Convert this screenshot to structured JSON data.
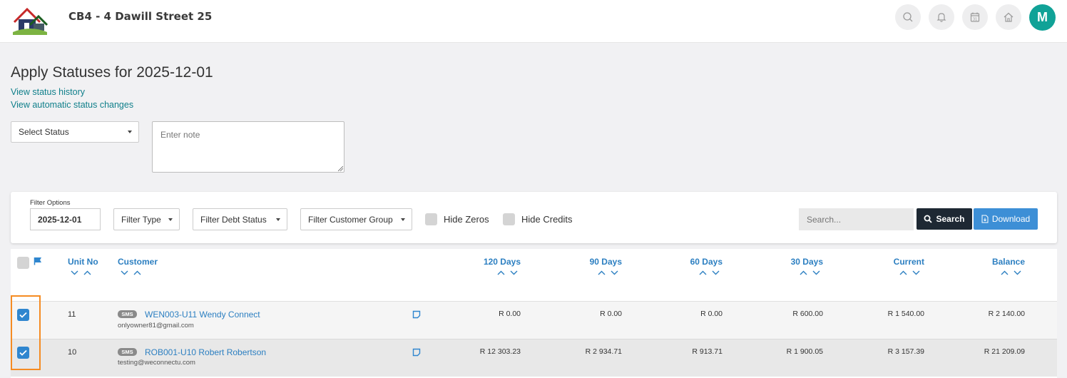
{
  "header": {
    "title": "CB4 - 4 Dawill Street 25",
    "avatar_letter": "M",
    "icons": [
      "search-icon",
      "bell-icon",
      "calendar-icon",
      "home-icon"
    ],
    "calendar_day": "31",
    "colors": {
      "avatar": "#10a297",
      "link": "#0f7f8a",
      "accent": "#2c7fc1",
      "highlight": "#f58b22"
    }
  },
  "page": {
    "title": "Apply Statuses for 2025-12-01",
    "link_history": "View status history",
    "link_auto": "View automatic status changes",
    "select_status": "Select Status",
    "note_placeholder": "Enter note"
  },
  "filters": {
    "label": "Filter Options",
    "date": "2025-12-01",
    "type": "Filter Type",
    "debt_status": "Filter Debt Status",
    "customer_group": "Filter Customer Group",
    "hide_zeros": "Hide Zeros",
    "hide_credits": "Hide Credits",
    "search_placeholder": "Search...",
    "search_button": "Search",
    "download_button": "Download"
  },
  "table": {
    "headers": {
      "unit_no": "Unit No",
      "customer": "Customer",
      "d120": "120 Days",
      "d90": "90 Days",
      "d60": "60 Days",
      "d30": "30 Days",
      "current": "Current",
      "balance": "Balance"
    },
    "rows": [
      {
        "checked": true,
        "unit": "11",
        "badge": "SMS",
        "customer": "WEN003-U11 Wendy Connect",
        "email": "onlyowner81@gmail.com",
        "d120": "R 0.00",
        "d90": "R 0.00",
        "d60": "R 0.00",
        "d30": "R 600.00",
        "current": "R 1 540.00",
        "balance": "R 2 140.00"
      },
      {
        "checked": true,
        "unit": "10",
        "badge": "SMS",
        "customer": "ROB001-U10 Robert Robertson",
        "email": "testing@weconnectu.com",
        "d120": "R 12 303.23",
        "d90": "R 2 934.71",
        "d60": "R 913.71",
        "d30": "R 1 900.05",
        "current": "R 3 157.39",
        "balance": "R 21 209.09"
      }
    ]
  }
}
